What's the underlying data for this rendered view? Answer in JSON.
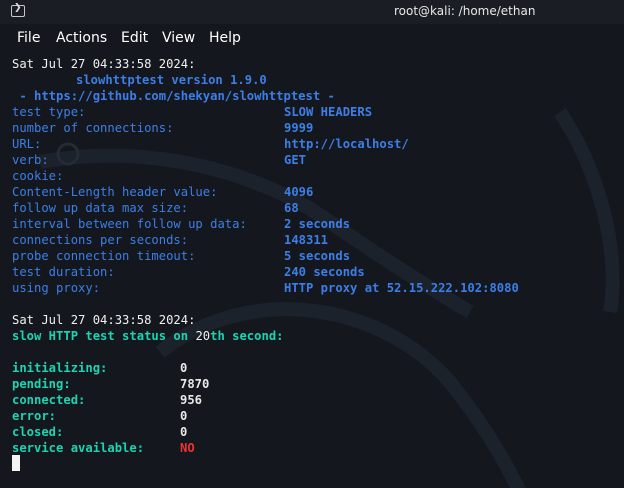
{
  "window": {
    "title": "root@kali: /home/ethan",
    "icon": "terminal-icon"
  },
  "menu": [
    "File",
    "Actions",
    "Edit",
    "View",
    "Help"
  ],
  "terminal": {
    "timestamp1": "Sat Jul 27 04:33:58 2024:",
    "version_line": "slowhttptest version 1.9.0",
    "url_line": " - https://github.com/shekyan/slowhttptest -",
    "config": [
      {
        "label": "test type:",
        "value": "SLOW HEADERS"
      },
      {
        "label": "number of connections:",
        "value": "9999"
      },
      {
        "label": "URL:",
        "value": "http://localhost/"
      },
      {
        "label": "verb:",
        "value": "GET"
      },
      {
        "label": "cookie:",
        "value": ""
      },
      {
        "label": "Content-Length header value:",
        "value": "4096"
      },
      {
        "label": "follow up data max size:",
        "value": "68"
      },
      {
        "label": "interval between follow up data:",
        "value": "2 seconds"
      },
      {
        "label": "connections per seconds:",
        "value": "148311"
      },
      {
        "label": "probe connection timeout:",
        "value": "5 seconds"
      },
      {
        "label": "test duration:",
        "value": "240 seconds"
      },
      {
        "label": "using proxy:",
        "value": "HTTP proxy at 52.15.222.102:8080"
      }
    ],
    "timestamp2": "Sat Jul 27 04:33:58 2024:",
    "status_prefix": "slow HTTP test status on ",
    "status_seconds": "20",
    "status_suffix": "th second:",
    "status": [
      {
        "label": "initializing:",
        "value": "0"
      },
      {
        "label": "pending:",
        "value": "7870"
      },
      {
        "label": "connected:",
        "value": "956"
      },
      {
        "label": "error:",
        "value": "0"
      },
      {
        "label": "closed:",
        "value": "0"
      },
      {
        "label": "service available:",
        "value": "NO"
      }
    ],
    "colors": {
      "label": "#3d7ee6",
      "status_label": "#1ed3b0",
      "alert": "#ee3333"
    }
  }
}
